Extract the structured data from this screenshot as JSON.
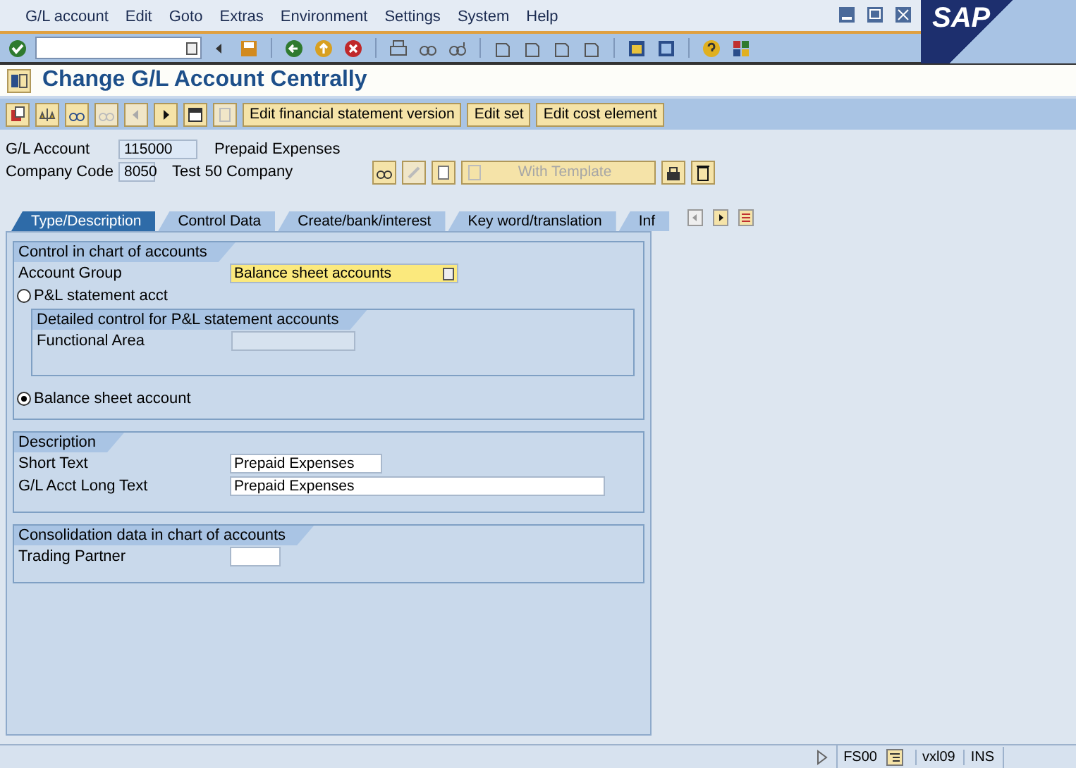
{
  "logo": "SAP",
  "menu": [
    "G/L account",
    "Edit",
    "Goto",
    "Extras",
    "Environment",
    "Settings",
    "System",
    "Help"
  ],
  "title": "Change G/L Account Centrally",
  "app_toolbar": {
    "buttons": [
      "Edit financial statement version",
      "Edit set",
      "Edit cost element"
    ]
  },
  "header_fields": [
    {
      "label": "G/L Account",
      "value": "115000",
      "text": "Prepaid Expenses"
    },
    {
      "label": "Company Code",
      "value": "8050",
      "text": "Test 50 Company"
    }
  ],
  "template_button": {
    "label": "With Template",
    "disabled": true
  },
  "tabs": [
    {
      "label": "Type/Description",
      "selected": true
    },
    {
      "label": "Control Data",
      "selected": false
    },
    {
      "label": "Create/bank/interest",
      "selected": false
    },
    {
      "label": "Key word/translation",
      "selected": false
    },
    {
      "label": "Inf",
      "selected": false
    }
  ],
  "control_group": {
    "title": "Control in chart of accounts",
    "account_group": {
      "label": "Account Group",
      "value": "Balance sheet accounts"
    },
    "radios": [
      {
        "label": "P&L statement acct",
        "selected": false
      },
      {
        "label": "Balance sheet account",
        "selected": true
      }
    ],
    "detail_group": {
      "title": "Detailed control for P&L statement accounts",
      "field": {
        "label": "Functional Area",
        "disabled": true
      }
    }
  },
  "description_group": {
    "title": "Description",
    "fields": [
      {
        "label": "Short Text",
        "value": "Prepaid Expenses"
      },
      {
        "label": "G/L Acct Long Text",
        "value": "Prepaid Expenses"
      }
    ]
  },
  "consolidation_group": {
    "title": "Consolidation data in chart of accounts",
    "fields": [
      {
        "label": "Trading Partner"
      }
    ]
  },
  "status_bar": {
    "transaction": "FS00",
    "user": "vxl09",
    "mode": "INS"
  }
}
